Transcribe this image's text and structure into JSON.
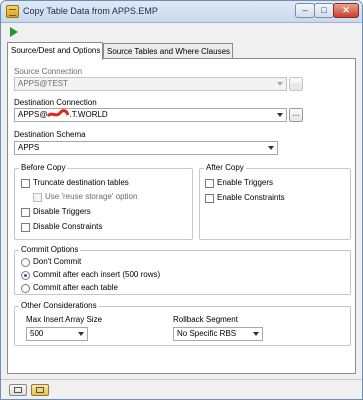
{
  "window": {
    "title": "Copy Table Data from APPS.EMP",
    "controls": {
      "minimize": "–",
      "maximize": "□",
      "close": "✕"
    }
  },
  "toolbar": {
    "run_icon": "run-triangle-icon",
    "run_color": "#1c9a2a"
  },
  "tabs": [
    {
      "label": "Source/Dest and Options",
      "active": true
    },
    {
      "label": "Source Tables and Where Clauses",
      "active": false
    }
  ],
  "source_connection": {
    "label": "Source Connection",
    "value": "APPS@TEST",
    "ellipsis": "..."
  },
  "destination_connection": {
    "label": "Destination Connection",
    "value_prefix": "APPS@",
    "value_suffix": ".T.WORLD",
    "ellipsis": "..."
  },
  "destination_schema": {
    "label": "Destination Schema",
    "value": "APPS"
  },
  "before_copy": {
    "title": "Before Copy",
    "options": [
      {
        "label": "Truncate destination tables",
        "checked": false,
        "enabled": true
      },
      {
        "label": "Use 'reuse storage' option",
        "checked": false,
        "enabled": false
      },
      {
        "label": "Disable Triggers",
        "checked": false,
        "enabled": true
      },
      {
        "label": "Disable Constraints",
        "checked": false,
        "enabled": true
      }
    ]
  },
  "after_copy": {
    "title": "After Copy",
    "options": [
      {
        "label": "Enable Triggers",
        "checked": false
      },
      {
        "label": "Enable Constraints",
        "checked": false
      }
    ]
  },
  "commit_options": {
    "title": "Commit Options",
    "options": [
      {
        "label": "Don't Commit",
        "checked": false
      },
      {
        "label": "Commit after each insert (500 rows)",
        "checked": true
      },
      {
        "label": "Commit after each table",
        "checked": false
      }
    ]
  },
  "other_considerations": {
    "title": "Other Considerations",
    "max_insert_array_size": {
      "label": "Max Insert Array Size",
      "value": "500"
    },
    "rollback_segment": {
      "label": "Rollback Segment",
      "value": "No Specific RBS"
    }
  },
  "colors": {
    "accent": "#1b5fb0",
    "redaction": "#e0261b"
  }
}
